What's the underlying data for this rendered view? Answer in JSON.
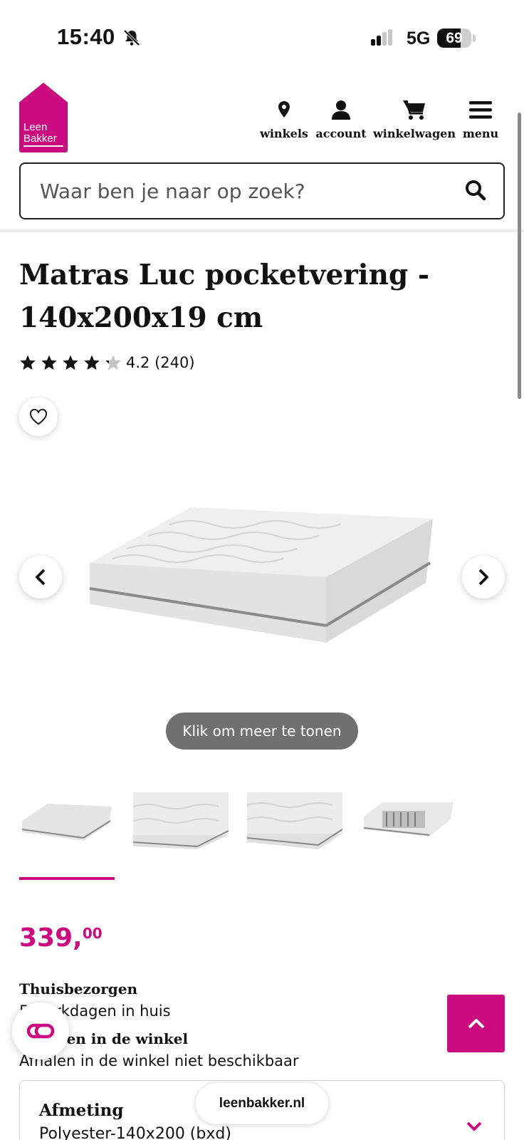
{
  "status_bar": {
    "time": "15:40",
    "network": "5G",
    "battery": "69",
    "battery_level": 0.69
  },
  "header": {
    "logo": {
      "line1": "Leen",
      "line2": "Bakker"
    },
    "nav": {
      "stores": "winkels",
      "account": "account",
      "cart": "winkelwagen",
      "menu": "menu"
    }
  },
  "search": {
    "placeholder": "Waar ben je naar op zoek?"
  },
  "product": {
    "title": "Matras Luc pocketvering - 140x200x19 cm",
    "rating_text": "4.2 (240)",
    "rating": 4.2,
    "rating_max": 5,
    "show_more": "Klik om meer te tonen",
    "price_whole": "339,",
    "price_cents": "00"
  },
  "delivery": {
    "home_title": "Thuisbezorgen",
    "home_text": "5 werkdagen in huis",
    "pickup_title": "Ophalen in de winkel",
    "pickup_text": "Afhalen in de winkel niet beschikbaar"
  },
  "size": {
    "label": "Afmeting",
    "value": "Polyester-140x200 (bxd)"
  },
  "browser": {
    "url": "leenbakker.nl"
  },
  "colors": {
    "brand": "#cc0a7f",
    "pill_grey": "#707070"
  }
}
